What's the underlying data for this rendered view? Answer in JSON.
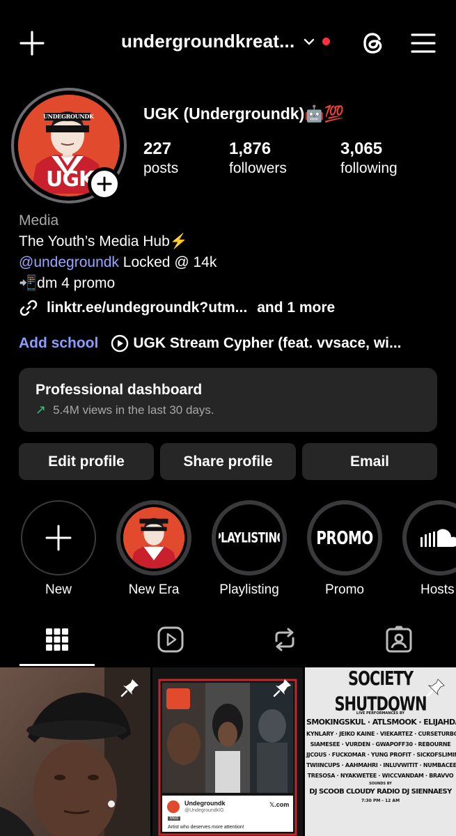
{
  "topbar": {
    "username": "undergroundkreat...",
    "icons": [
      "plus-icon",
      "chevron-down-icon",
      "threads-icon",
      "menu-icon"
    ],
    "notification_color": "#ff3040"
  },
  "profile": {
    "display_name": "UGK (Undergroundk)🤖💯",
    "avatar_text": "UGK",
    "avatar_banner": "UNDEGROUNDK",
    "stats": [
      {
        "value": "227",
        "label": "posts"
      },
      {
        "value": "1,876",
        "label": "followers"
      },
      {
        "value": "3,065",
        "label": "following"
      }
    ],
    "category": "Media",
    "bio_line1": "The Youth’s Media Hub⚡️",
    "bio_mention": "@undegroundk",
    "bio_mention_rest": " Locked @ 14k",
    "bio_line3": "📲dm 4 promo",
    "link": "linktr.ee/undegroundk?utm...",
    "link_more": "and 1 more",
    "add_school": "Add school",
    "music": "UGK Stream Cypher (feat. vvsace, wi..."
  },
  "dashboard": {
    "title": "Professional dashboard",
    "arrow": "↗",
    "subtitle": "5.4M views in the last 30 days."
  },
  "buttons": {
    "edit": "Edit profile",
    "share": "Share profile",
    "email": "Email"
  },
  "highlights": [
    {
      "label": "New"
    },
    {
      "label": "New Era"
    },
    {
      "label": "Playlisting",
      "cover_text": "PLAYLISTING"
    },
    {
      "label": "Promo",
      "cover_text": "PROMO"
    },
    {
      "label": "Hosts"
    }
  ],
  "tabs": [
    "grid-icon",
    "reels-icon",
    "reposts-icon",
    "tagged-icon"
  ],
  "posts": {
    "post2": {
      "tweet_name": "Undegroundk",
      "tweet_handle": "@UndegroundkIG",
      "tweet_badge": "Mod",
      "tweet_text": "Artist who deserves more attention!",
      "tweet_site": "𝕏.com"
    },
    "post3": {
      "title": "SOCIETY SHUTDOWN",
      "subtitle": "LIVE PERFORMANCES BY",
      "headliners": "SMOKINGSKUL · ATLSMOOK · ELIJAHDAEAGLE",
      "lines": [
        "KYNLARY · JEIKO KAINE · VIEKARTEZ · CURSETURBO",
        "SIAMESEE · VURDEN · GWAPOFF30 · REBOURNE",
        "JJCOUS · FUCKOMAR · YUNG PROFIT · SICKOFSLIMING",
        "TWIINCUPS · AAHMAHRI · INLUVWITIT · NUMBACEE",
        "TRESOSA · NYAKWETEE · WICCVANDAM · BRAVVO"
      ],
      "sounds_by": "SOUNDS BY",
      "djs": "DJ SCOOB CLOUDY RADIO DJ SIENNAESY",
      "time": "7:30 PM - 12 AM"
    }
  }
}
